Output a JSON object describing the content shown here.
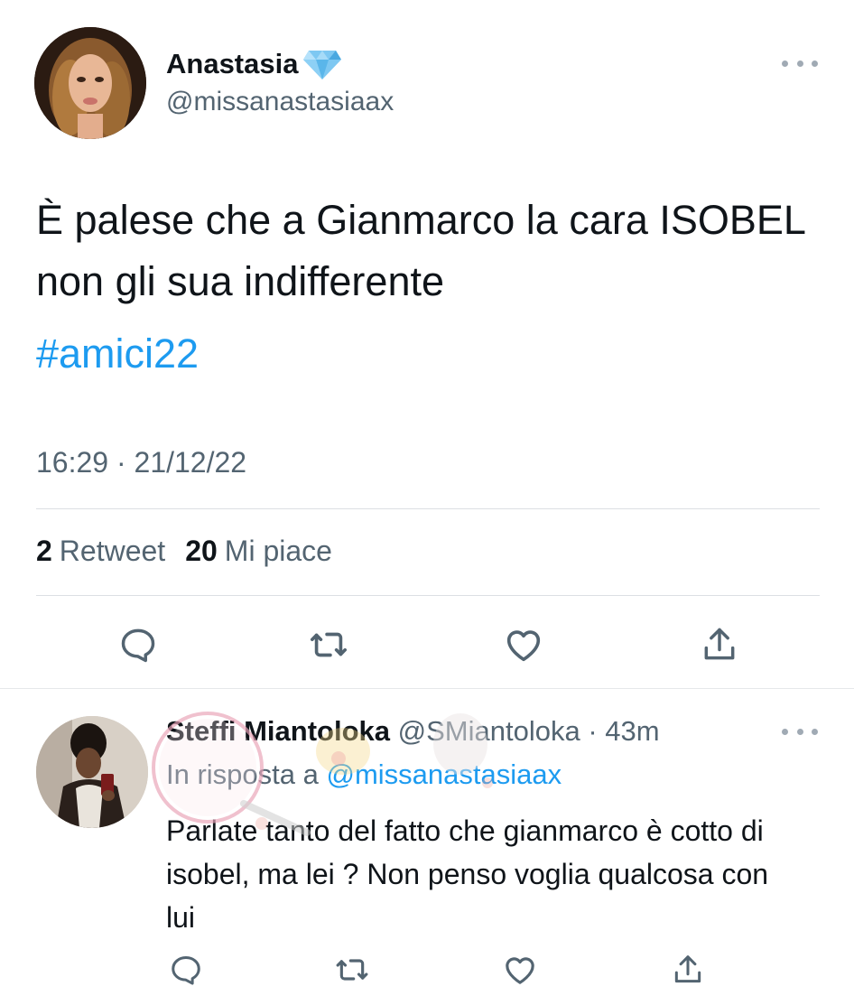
{
  "main_tweet": {
    "author_name": "Anastasia",
    "author_handle": "@missanastasiaax",
    "text": "È palese che a Gianmarco la cara ISOBEL non gli sua indifferente",
    "hashtag": "#amici22",
    "timestamp": "16:29 · 21/12/22",
    "retweets_count": "2",
    "retweets_label": "Retweet",
    "likes_count": "20",
    "likes_label": "Mi piace",
    "badge_icon": "diamond-icon"
  },
  "reply": {
    "author_name": "Steffi Miantoloka",
    "author_handle": "@SMiantoloka",
    "time": "· 43m",
    "reply_to_label": "In risposta a",
    "reply_to_handle": "@missanastasiaax",
    "text": "Parlate tanto del fatto che gianmarco è cotto di isobel, ma lei ? Non penso voglia qualcosa con lui"
  },
  "colors": {
    "text_primary": "#0f1419",
    "text_secondary": "#536471",
    "link_blue": "#1d9bf0",
    "divider": "#dcdfe3"
  }
}
